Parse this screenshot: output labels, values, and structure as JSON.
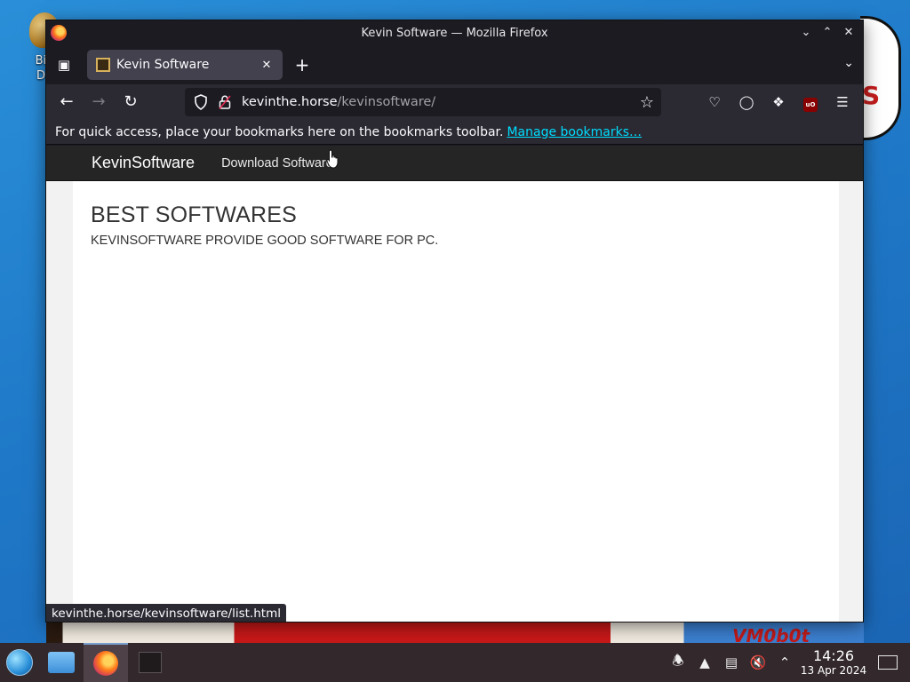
{
  "desktop": {
    "icon_label": "Big\nDe",
    "wallpaper_text": "VM0b0t"
  },
  "window": {
    "title": "Kevin Software — Mozilla Firefox"
  },
  "tabs": [
    {
      "title": "Kevin Software"
    }
  ],
  "urlbar": {
    "host": "kevinthe.horse",
    "path": "/kevinsoftware/"
  },
  "bookmarks_toolbar": {
    "message": "For quick access, place your bookmarks here on the bookmarks toolbar.",
    "manage_link": "Manage bookmarks…"
  },
  "site": {
    "brand": "KevinSoftware",
    "nav_link": "Download Software",
    "heading": "BEST SOFTWARES",
    "tagline": "KEVINSOFTWARE PROVIDE GOOD SOFTWARE FOR PC."
  },
  "status_link": "kevinthe.horse/kevinsoftware/list.html",
  "taskbar": {
    "time": "14:26",
    "date": "13 Apr 2024"
  },
  "icons": {
    "tab_list": "tab-list-icon",
    "new_tab": "plus-icon",
    "back": "arrow-left-icon",
    "forward": "arrow-right-icon",
    "reload": "reload-icon",
    "bookmark_star": "star-icon",
    "pocket": "pocket-icon",
    "account": "account-icon",
    "extensions": "puzzle-icon",
    "ublock": "ublock-icon",
    "menu": "hamburger-icon"
  }
}
